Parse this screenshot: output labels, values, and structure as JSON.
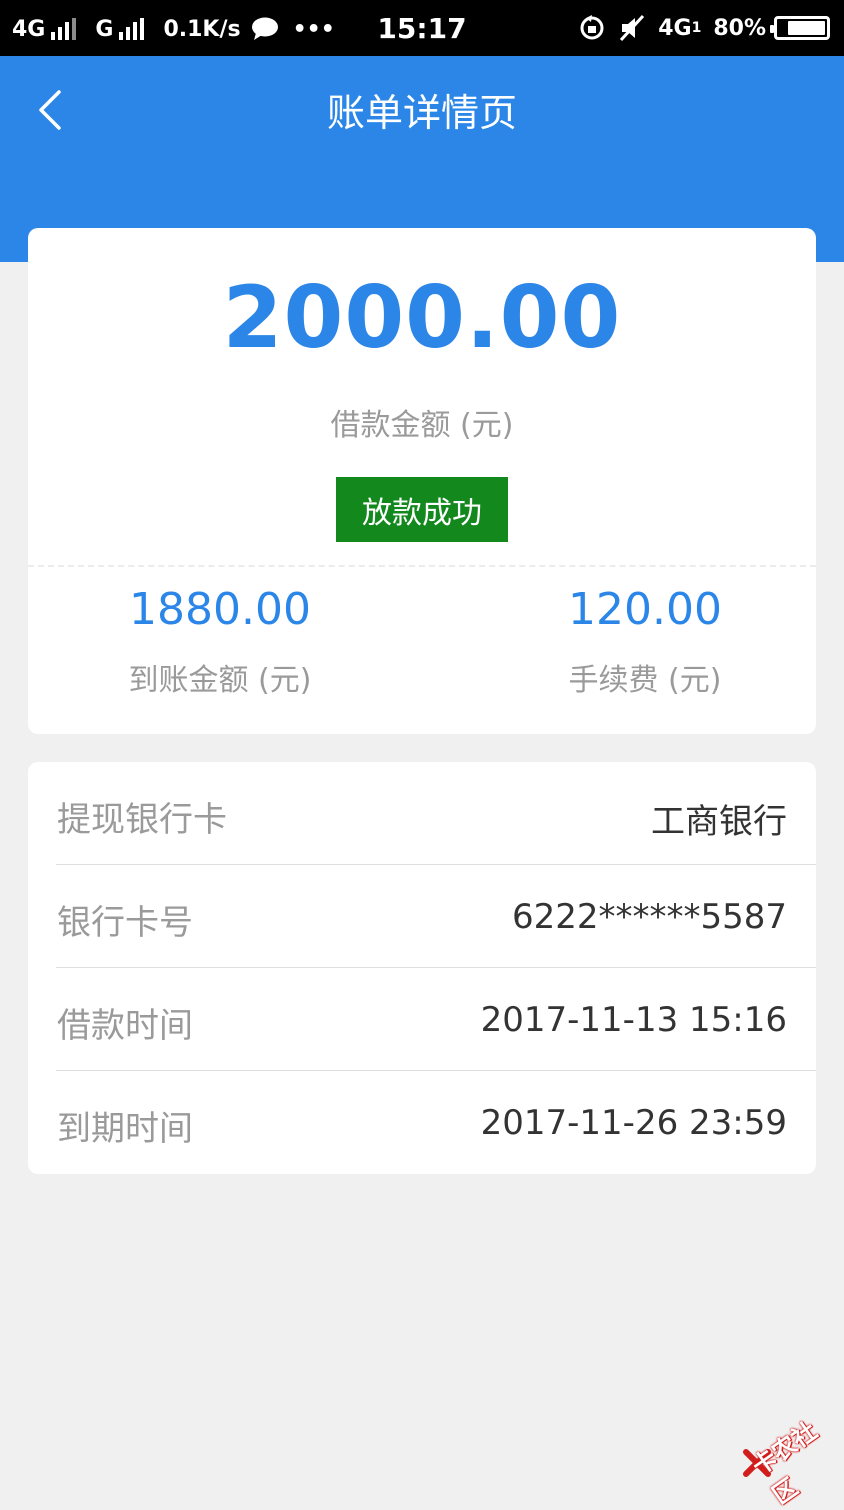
{
  "status_bar": {
    "network1": "4G",
    "network2": "G",
    "speed": "0.1K/s",
    "more": "•••",
    "time": "15:17",
    "network3": "4G",
    "network3_sub": "1",
    "battery": "80%",
    "battery_level": 0.8
  },
  "header": {
    "title": "账单详情页"
  },
  "summary": {
    "loan_amount": "2000.00",
    "loan_amount_label": "借款金额 (元)",
    "status": "放款成功",
    "received_amount": "1880.00",
    "received_label": "到账金额 (元)",
    "fee": "120.00",
    "fee_label": "手续费 (元)"
  },
  "details": [
    {
      "label": "提现银行卡",
      "value": "工商银行"
    },
    {
      "label": "银行卡号",
      "value": "6222******5587"
    },
    {
      "label": "借款时间",
      "value": "2017-11-13  15:16"
    },
    {
      "label": "到期时间",
      "value": "2017-11-26  23:59"
    }
  ],
  "watermark": "卡农社区",
  "colors": {
    "primary": "#2b86e8",
    "success": "#12881d",
    "background": "#f0f0f0"
  }
}
